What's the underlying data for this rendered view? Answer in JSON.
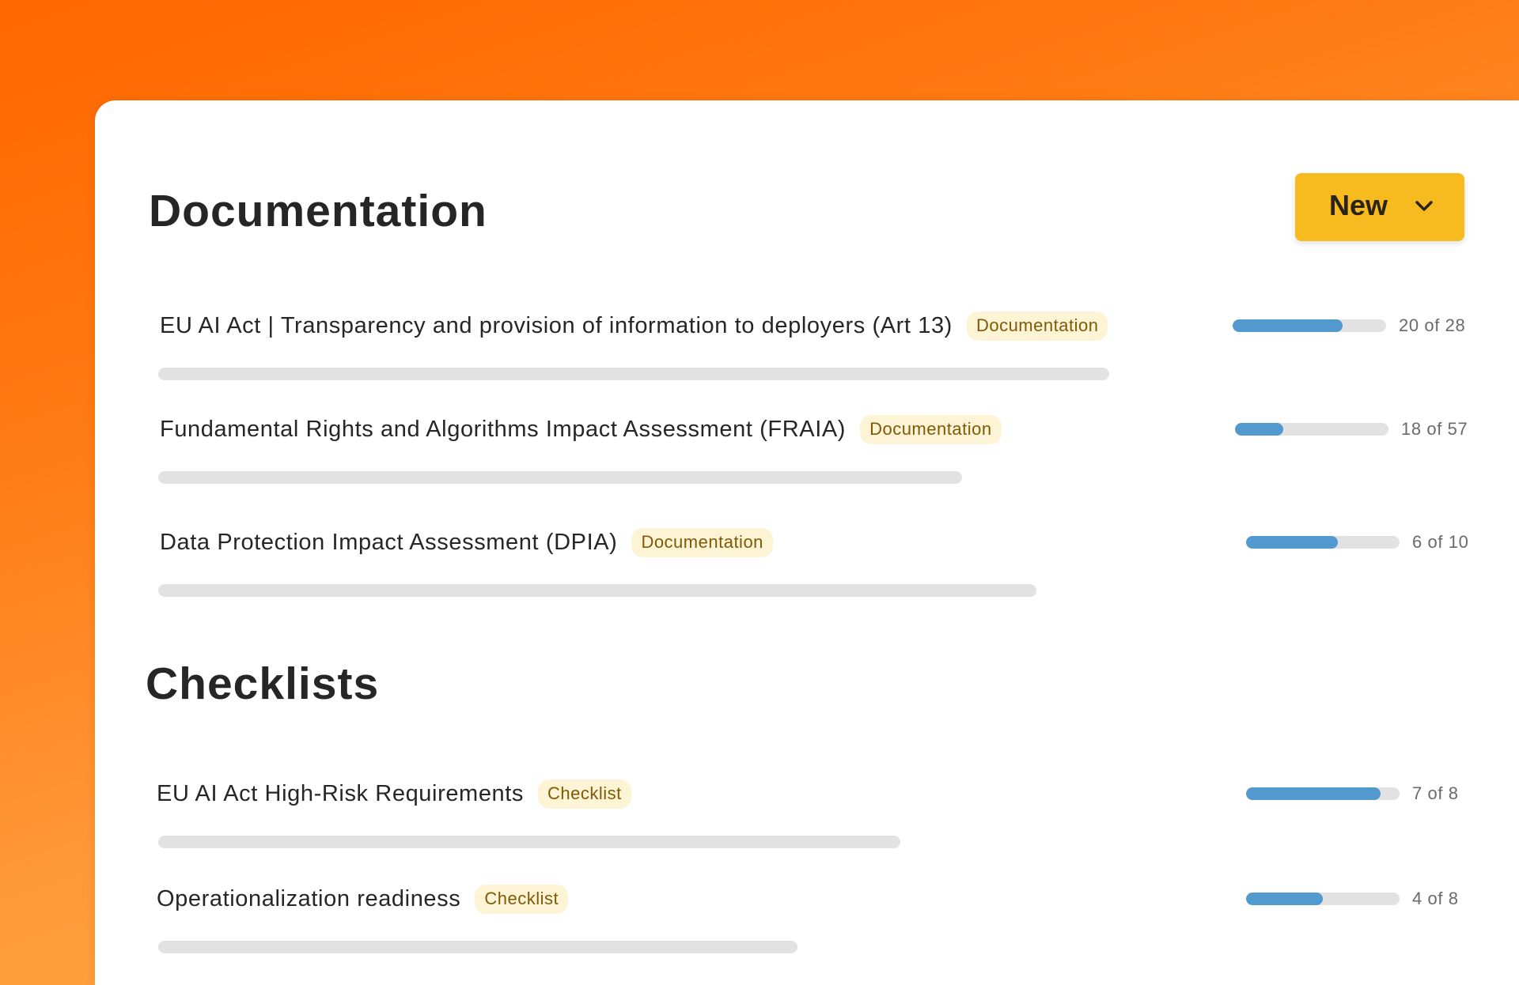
{
  "new_button": {
    "label": "New"
  },
  "sections": [
    {
      "title": "Documentation",
      "items": [
        {
          "title": "EU AI Act | Transparency and provision of information to deployers (Art 13)",
          "badge": "Documentation",
          "progress_done": 20,
          "progress_total": 28,
          "progress_text": "20 of 28"
        },
        {
          "title": "Fundamental Rights and Algorithms Impact Assessment (FRAIA)",
          "badge": "Documentation",
          "progress_done": 18,
          "progress_total": 57,
          "progress_text": "18 of 57"
        },
        {
          "title": "Data Protection Impact Assessment (DPIA)",
          "badge": "Documentation",
          "progress_done": 6,
          "progress_total": 10,
          "progress_text": "6 of 10"
        }
      ]
    },
    {
      "title": "Checklists",
      "items": [
        {
          "title": "EU AI Act High-Risk Requirements",
          "badge": "Checklist",
          "progress_done": 7,
          "progress_total": 8,
          "progress_text": "7 of 8"
        },
        {
          "title": "Operationalization readiness",
          "badge": "Checklist",
          "progress_done": 4,
          "progress_total": 8,
          "progress_text": "4 of 8"
        }
      ]
    }
  ],
  "colors": {
    "background_gradient_start": "#ff6600",
    "background_gradient_end": "#ffb04d",
    "button": "#f8bb1f",
    "badge_bg": "#fdf4d6",
    "badge_text": "#7f5a06",
    "progress_fill": "#5199cf",
    "progress_track": "#e2e2e2"
  },
  "icons": {
    "new_button": "chevron-down-icon"
  }
}
